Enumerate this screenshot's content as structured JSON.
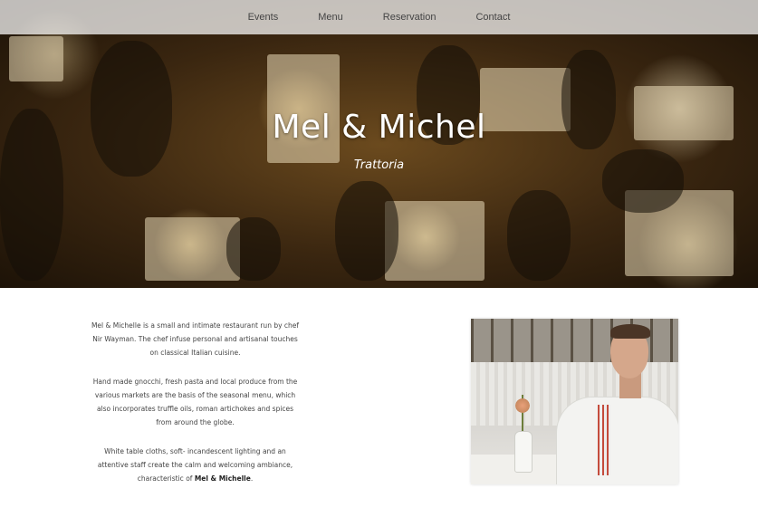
{
  "nav": {
    "items": [
      "Events",
      "Menu",
      "Reservation",
      "Contact"
    ]
  },
  "hero": {
    "title": "Mel & Michel",
    "subtitle": "Trattoria"
  },
  "about": {
    "p1": "Mel & Michelle is a small and intimate restaurant run by chef Nir Wayman. The chef infuse personal and artisanal touches on classical Italian cuisine.",
    "p2": "Hand made gnocchi, fresh pasta and local produce from the various markets are the basis of the seasonal menu, which also incorporates truffle oils, roman artichokes and spices from around the globe.",
    "p3_text": "White table cloths, soft- incandescent lighting and an attentive staff create the calm and welcoming ambiance, characteristic of ",
    "p3_bold": "Mel & Michelle",
    "p3_end": "."
  },
  "colors": {
    "nav_background": "#ffffff",
    "hero_overlay": "#3a2610",
    "text": "#444444"
  }
}
